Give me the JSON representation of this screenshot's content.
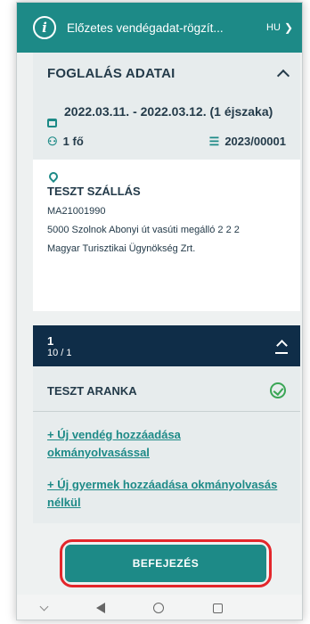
{
  "header": {
    "title": "Előzetes vendégadat-rögzít...",
    "language": "HU"
  },
  "booking": {
    "section_title": "FOGLALÁS ADATAI",
    "dates": "2022.03.11. - 2022.03.12. (1 éjszaka)",
    "guests": "1 fő",
    "reference": "2023/00001",
    "accommodation_name": "TESZT SZÁLLÁS",
    "registration_number": "MA21001990",
    "address": "5000 Szolnok Abonyi út vasúti megálló 2 2 2",
    "operator": "Magyar Turisztikai Ügynökség Zrt."
  },
  "guest_panel": {
    "number": "1",
    "subtitle": "10 / 1",
    "guest_name": "TESZT ARANKA",
    "add_guest_link": "+ Új vendég hozzáadása okmányolvasással",
    "add_child_link": "+ Új gyermek hozzáadása okmányolvasás nélkül"
  },
  "footer": {
    "finish_label": "BEFEJEZÉS"
  },
  "colors": {
    "accent": "#1d8a87",
    "dark_header": "#0f2d48",
    "highlight_ring": "#e3262b",
    "success": "#3aa655"
  }
}
